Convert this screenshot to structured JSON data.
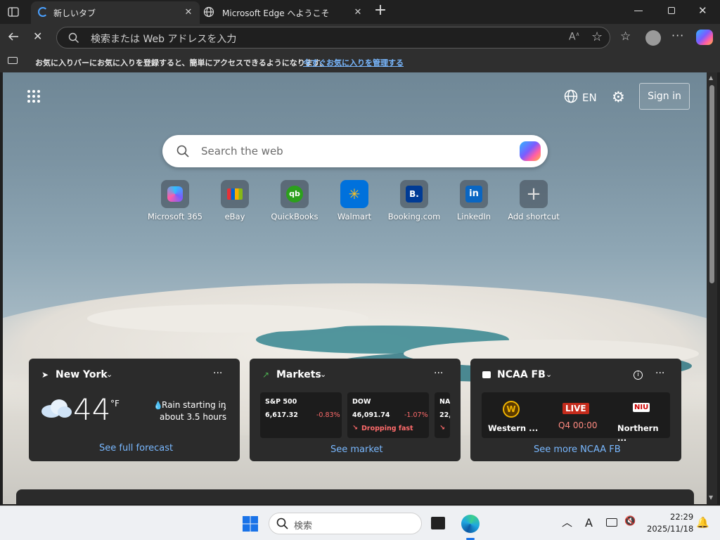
{
  "tabs": [
    {
      "title": "新しいタブ",
      "active": true
    },
    {
      "title": "Microsoft Edge へようこそ",
      "active": false
    }
  ],
  "address_bar": {
    "placeholder": "検索または Web アドレスを入力"
  },
  "favorites_bar": {
    "message": "お気に入りバーにお気に入りを登録すると、簡単にアクセスできるようになります。",
    "link": "今すぐお気に入りを管理する"
  },
  "header": {
    "language": "EN",
    "sign_in": "Sign in"
  },
  "search": {
    "placeholder": "Search the web"
  },
  "shortcuts": [
    {
      "label": "Microsoft 365",
      "icon": "microsoft-365-icon"
    },
    {
      "label": "eBay",
      "icon": "ebay-icon"
    },
    {
      "label": "QuickBooks",
      "icon": "quickbooks-icon"
    },
    {
      "label": "Walmart",
      "icon": "walmart-icon"
    },
    {
      "label": "Booking.com",
      "icon": "booking-icon"
    },
    {
      "label": "LinkedIn",
      "icon": "linkedin-icon"
    },
    {
      "label": "Add shortcut",
      "icon": "plus-icon"
    }
  ],
  "weather": {
    "location": "New York",
    "temp": "44",
    "unit": "°F",
    "forecast_line1": "Rain starting in",
    "forecast_line2": "about 3.5 hours",
    "link": "See full forecast"
  },
  "markets": {
    "title": "Markets",
    "link": "See market",
    "stocks": [
      {
        "name": "S&P 500",
        "value": "6,617.32",
        "change": "-0.83%",
        "note": ""
      },
      {
        "name": "DOW",
        "value": "46,091.74",
        "change": "-1.07%",
        "note": "Dropping fast"
      },
      {
        "name": "NA",
        "value": "22,",
        "change": "",
        "note": ""
      }
    ]
  },
  "sports": {
    "title": "NCAA FB",
    "status": "LIVE",
    "time": "Q4 00:00",
    "team1": "Western ...",
    "team2": "Northern ...",
    "team1_logo": "W",
    "team2_logo": "NIU",
    "link": "See more NCAA FB"
  },
  "taskbar": {
    "search_placeholder": "検索",
    "ime": "A",
    "time": "22:29",
    "date": "2025/11/18"
  },
  "colors": {
    "accent_link": "#79b8ff",
    "live_red": "#c42b1c",
    "negative": "#ff6b6b"
  }
}
